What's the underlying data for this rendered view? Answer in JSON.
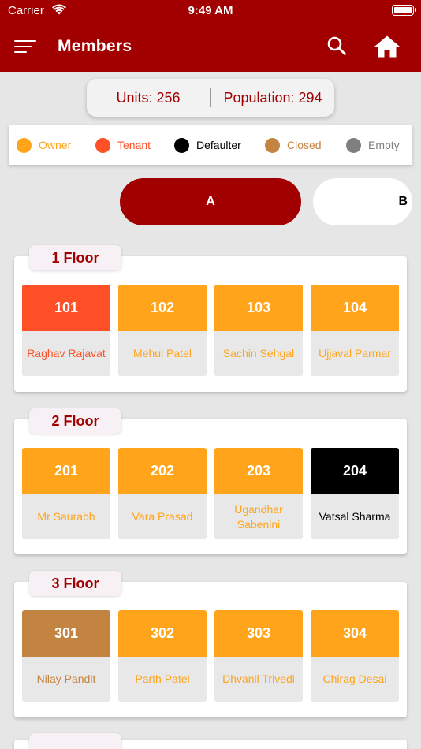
{
  "status_bar": {
    "carrier": "Carrier",
    "time": "9:49 AM"
  },
  "header": {
    "title": "Members",
    "menu_icon": "hamburger-menu-icon",
    "search_icon": "search-icon",
    "home_icon": "home-icon"
  },
  "summary": {
    "units": "Units: 256",
    "population": "Population: 294"
  },
  "colors": {
    "primary": "#a20000",
    "owner": "#ffa41b",
    "tenant": "#ff5027",
    "defaulter": "#000000",
    "closed": "#c48441",
    "empty": "#7f7f7f"
  },
  "legend": [
    {
      "label": "Owner",
      "color": "#ffa41b"
    },
    {
      "label": "Tenant",
      "color": "#ff5027"
    },
    {
      "label": "Defaulter",
      "color": "#000000"
    },
    {
      "label": "Closed",
      "color": "#c48441"
    },
    {
      "label": "Empty",
      "color": "#7f7f7f"
    }
  ],
  "blocks": [
    {
      "label": "A",
      "selected": true
    },
    {
      "label": "B",
      "selected": false
    }
  ],
  "floors": [
    {
      "label": "1 Floor",
      "units": [
        {
          "number": "101",
          "name": "Raghav Rajavat",
          "status": "tenant"
        },
        {
          "number": "102",
          "name": "Mehul Patel",
          "status": "owner"
        },
        {
          "number": "103",
          "name": "Sachin Sehgal",
          "status": "owner"
        },
        {
          "number": "104",
          "name": "Ujjaval Parmar",
          "status": "owner"
        }
      ]
    },
    {
      "label": "2 Floor",
      "units": [
        {
          "number": "201",
          "name": "Mr Saurabh",
          "status": "owner"
        },
        {
          "number": "202",
          "name": "Vara Prasad",
          "status": "owner"
        },
        {
          "number": "203",
          "name": "Ugandhar Sabenini",
          "status": "owner"
        },
        {
          "number": "204",
          "name": "Vatsal Sharma",
          "status": "defaulter"
        }
      ]
    },
    {
      "label": "3 Floor",
      "units": [
        {
          "number": "301",
          "name": "Nilay Pandit",
          "status": "closed"
        },
        {
          "number": "302",
          "name": "Parth Patel",
          "status": "owner"
        },
        {
          "number": "303",
          "name": "Dhvanil Trivedi",
          "status": "owner"
        },
        {
          "number": "304",
          "name": "Chirag Desai",
          "status": "owner"
        }
      ]
    }
  ]
}
